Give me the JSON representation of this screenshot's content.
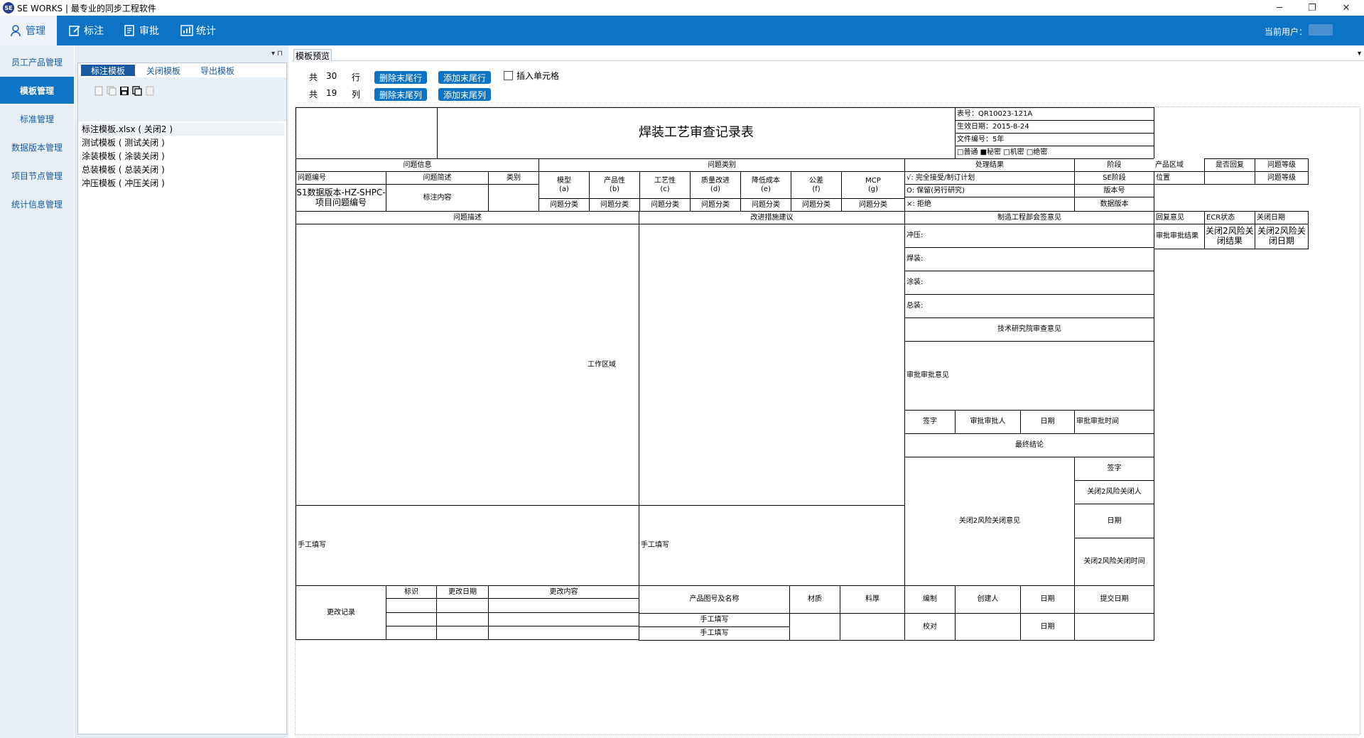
{
  "window": {
    "app_title": "SE WORKS | 最专业的同步工程软件",
    "logo_text": "SE",
    "minimize": "─",
    "maximize": "❐",
    "close": "✕"
  },
  "menubar": {
    "tabs": [
      {
        "label": "管理",
        "icon": "user-icon"
      },
      {
        "label": "标注",
        "icon": "edit-icon"
      },
      {
        "label": "审批",
        "icon": "approve-icon"
      },
      {
        "label": "统计",
        "icon": "chart-icon"
      }
    ],
    "current_user_label": "当前用户："
  },
  "sidebar": {
    "items": [
      "员工产品管理",
      "模板管理",
      "标准管理",
      "数据版本管理",
      "项目节点管理",
      "统计信息管理"
    ],
    "active_index": 1
  },
  "template_panel": {
    "tabs": [
      "标注模板",
      "关闭模板",
      "导出模板"
    ],
    "pin": "▾ ⊓",
    "items": [
      "标注模板.xlsx ( 关闭2 )",
      "测试模板 ( 测试关闭 )",
      "涂装模板 ( 涂装关闭 )",
      "总装模板 ( 总装关闭 )",
      "冲压模板 ( 冲压关闭 )"
    ]
  },
  "preview": {
    "header": "模板预览",
    "rows_prefix": "共",
    "rows_count": "30",
    "rows_unit": "行",
    "cols_prefix": "共",
    "cols_count": "19",
    "cols_unit": "列",
    "delete_last_row": "删除末尾行",
    "add_last_row": "添加末尾行",
    "delete_last_col": "删除末尾列",
    "add_last_col": "添加末尾列",
    "insert_cell": "插入单元格"
  },
  "sheet": {
    "title": "焊装工艺审查记录表",
    "form_no": "表号：QR10023-121A",
    "effective_date": "生效日期：2015-8-24",
    "doc_no": "文件编号：5年",
    "secrecy": "□普通  ■秘密  □机密  □绝密",
    "issue_info": "问题信息",
    "issue_category": "问题类别",
    "result": "处理结果",
    "stage": "阶段",
    "product_area": "产品区域",
    "replied": "是否回复",
    "issue_level": "问题等级",
    "issue_no": "问题编号",
    "issue_desc_short": "问题简述",
    "category": "类别",
    "model": "模型\n(a)",
    "productivity": "产品性\n(b)",
    "process": "工艺性\n(c)",
    "quality": "质量改进\n(d)",
    "cost": "降低成本\n(e)",
    "tolerance": "公差\n(f)",
    "mcp": "MCP\n(g)",
    "res1": "√: 完全接受/制订计划",
    "res2": "O: 保留(另行研究)",
    "res3": "×: 拒绝",
    "se_stage": "SE阶段",
    "version": "版本号",
    "data_version": "数据版本",
    "position": "位置",
    "issue_level_val": "问题等级",
    "s1_no": "S1数据版本-HZ-SHPC-项目问题编号",
    "annot": "标注内容",
    "issue_type": "问题分类",
    "issue_desc": "问题描述",
    "improve": "改进措施建议",
    "mfg_opinion": "制造工程部会签意见",
    "reply": "回复意见",
    "ecr": "ECR状态",
    "close_date": "关闭日期",
    "approve_result": "审批审批结果",
    "close_risk_result": "关闭2风险关闭结果",
    "close_risk_date": "关闭2风险关闭日期",
    "stamping": "冲压:",
    "welding": "焊装:",
    "painting": "涂装:",
    "assembly": "总装:",
    "tech_opinion": "技术研究院审查意见",
    "approve_opinion": "审批审批意见",
    "sign": "签字",
    "approver": "审批审批人",
    "date": "日期",
    "approve_time": "审批审批时间",
    "final": "最终结论",
    "closer": "关闭2风险关闭人",
    "close_opinion": "关闭2风险关闭意见",
    "close_time": "关闭2风险关闭时间",
    "work_area": "工作区域",
    "manual": "手工填写",
    "change_log": "更改记录",
    "mark": "标识",
    "change_date": "更改日期",
    "change_content": "更改内容",
    "part_name": "产品图号及名称",
    "material": "材质",
    "thickness": "料厚",
    "compile": "编制",
    "creator": "创建人",
    "submit_date": "提交日期",
    "check": "校对"
  }
}
